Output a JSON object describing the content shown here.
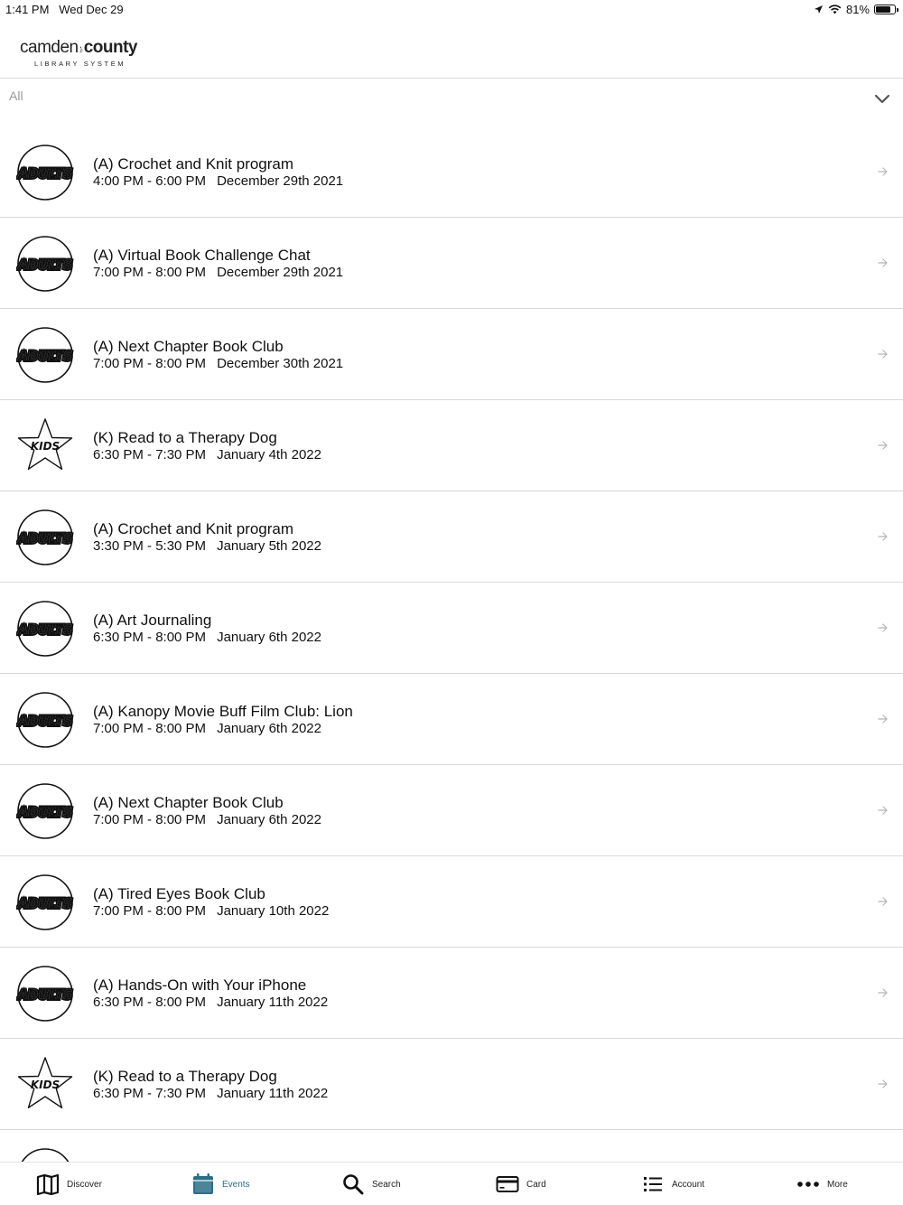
{
  "status_bar": {
    "time": "1:41 PM",
    "date": "Wed Dec 29",
    "battery": "81%",
    "battery_level": 0.81
  },
  "header": {
    "logo_text_a": "camden",
    "logo_text_b": "county",
    "logo_sub": "LIBRARY SYSTEM"
  },
  "filter": {
    "selected": "All"
  },
  "events": [
    {
      "badge": "ADULTS",
      "title": "(A) Crochet and Knit program",
      "time": "4:00 PM - 6:00 PM",
      "date": "December 29th 2021"
    },
    {
      "badge": "ADULTS",
      "title": "(A) Virtual Book Challenge Chat",
      "time": "7:00 PM - 8:00 PM",
      "date": "December 29th 2021"
    },
    {
      "badge": "ADULTS",
      "title": "(A) Next Chapter Book Club",
      "time": "7:00 PM - 8:00 PM",
      "date": "December 30th 2021"
    },
    {
      "badge": "KIDS",
      "title": "(K) Read to a Therapy Dog",
      "time": "6:30 PM - 7:30 PM",
      "date": "January 4th 2022"
    },
    {
      "badge": "ADULTS",
      "title": "(A) Crochet and Knit program",
      "time": "3:30 PM - 5:30 PM",
      "date": "January 5th 2022"
    },
    {
      "badge": "ADULTS",
      "title": "(A) Art Journaling",
      "time": "6:30 PM - 8:00 PM",
      "date": "January 6th 2022"
    },
    {
      "badge": "ADULTS",
      "title": "(A) Kanopy Movie Buff Film Club: Lion",
      "time": "7:00 PM - 8:00 PM",
      "date": "January 6th 2022"
    },
    {
      "badge": "ADULTS",
      "title": "(A) Next Chapter Book Club",
      "time": "7:00 PM - 8:00 PM",
      "date": "January 6th 2022"
    },
    {
      "badge": "ADULTS",
      "title": "(A) Tired Eyes Book Club",
      "time": "7:00 PM - 8:00 PM",
      "date": "January 10th 2022"
    },
    {
      "badge": "ADULTS",
      "title": "(A) Hands-On with Your iPhone",
      "time": "6:30 PM - 8:00 PM",
      "date": "January 11th 2022"
    },
    {
      "badge": "KIDS",
      "title": "(K) Read to a Therapy Dog",
      "time": "6:30 PM - 7:30 PM",
      "date": "January 11th 2022"
    },
    {
      "badge": "ADULTS",
      "title": "",
      "time": "",
      "date": ""
    }
  ],
  "tabs": [
    {
      "label": "Discover",
      "icon": "map-icon",
      "active": false
    },
    {
      "label": "Events",
      "icon": "calendar-icon",
      "active": true
    },
    {
      "label": "Search",
      "icon": "search-icon",
      "active": false
    },
    {
      "label": "Card",
      "icon": "card-icon",
      "active": false
    },
    {
      "label": "Account",
      "icon": "list-icon",
      "active": false
    },
    {
      "label": "More",
      "icon": "more-icon",
      "active": false
    }
  ],
  "colors": {
    "accent": "#2d6f86",
    "divider": "#d8d8d8",
    "muted": "#999999"
  }
}
